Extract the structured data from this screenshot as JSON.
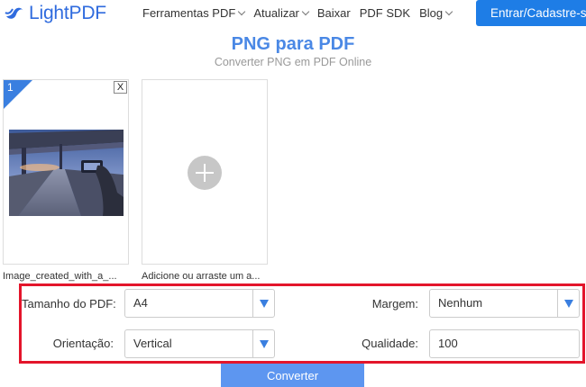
{
  "header": {
    "logo_text": "LightPDF",
    "nav": [
      {
        "label": "Ferramentas PDF",
        "has_dropdown": true
      },
      {
        "label": "Atualizar",
        "has_dropdown": true
      },
      {
        "label": "Baixar",
        "has_dropdown": false
      },
      {
        "label": "PDF SDK",
        "has_dropdown": false
      },
      {
        "label": "Blog",
        "has_dropdown": true
      }
    ],
    "cta_label": "Entrar/Cadastre-se"
  },
  "page": {
    "title": "PNG para PDF",
    "subtitle": "Converter PNG em PDF Online"
  },
  "files": [
    {
      "index": "1",
      "close_label": "X",
      "caption": "Image_created_with_a_..."
    }
  ],
  "add_card": {
    "caption": "Adicione ou arraste um a..."
  },
  "settings": {
    "page_size": {
      "label": "Tamanho do PDF:",
      "value": "A4"
    },
    "margin": {
      "label": "Margem:",
      "value": "Nenhum"
    },
    "orientation": {
      "label": "Orientação:",
      "value": "Vertical"
    },
    "quality": {
      "label": "Qualidade:",
      "value": "100"
    }
  },
  "convert_label": "Converter",
  "colors": {
    "brand": "#2f6bde",
    "cta": "#1e7de6",
    "title": "#4a88e5",
    "highlight_border": "#e3152b",
    "convert": "#5d96f0"
  }
}
